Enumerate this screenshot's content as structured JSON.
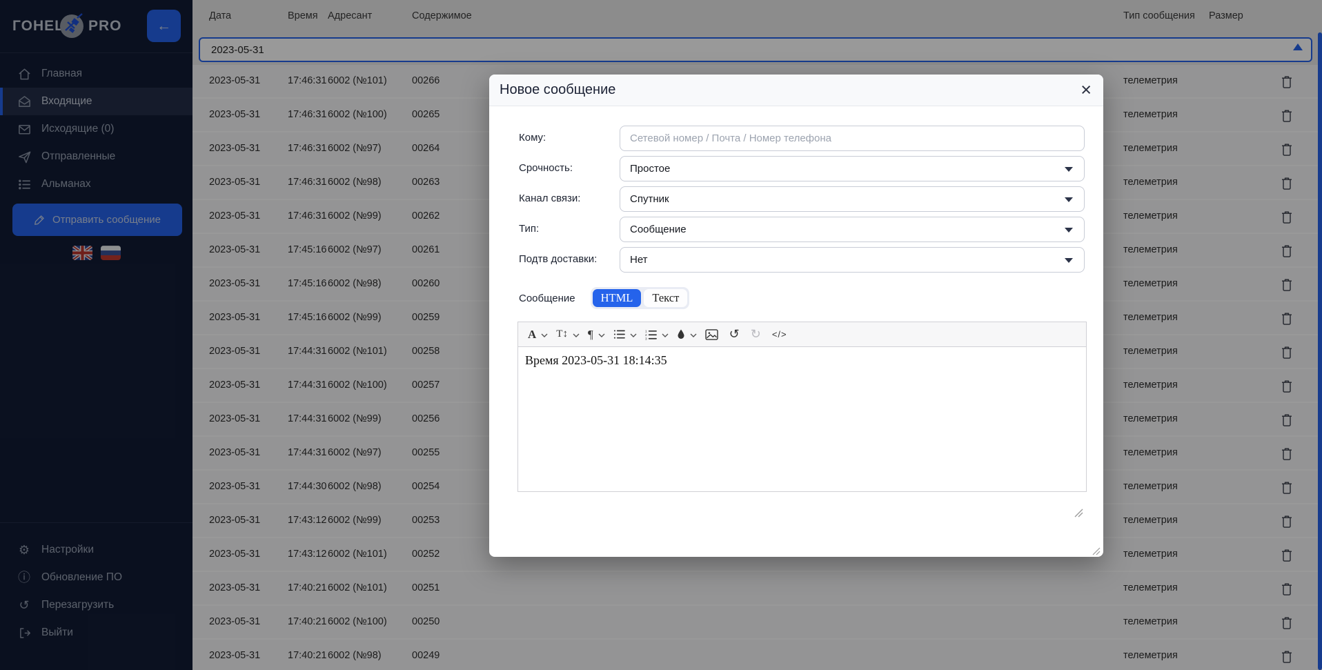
{
  "app": {
    "logo_left": "ГОНЕЦ",
    "logo_right": "PRO",
    "collapse_arrow": "←"
  },
  "colors": {
    "accent_blue": "#2563eb",
    "sidebar_bg": "#121c35",
    "table_header_bg": "#e9e9ea",
    "row_bg": "#f7f7f9",
    "modal_header_bg": "#f8f9fb"
  },
  "sidebar": {
    "nav": [
      {
        "label": "Главная",
        "icon": "home-icon",
        "active": false
      },
      {
        "label": "Входящие",
        "icon": "inbox-open-icon",
        "active": true
      },
      {
        "label": "Исходящие (0)",
        "icon": "envelope-icon",
        "active": false
      },
      {
        "label": "Отправленные",
        "icon": "paper-plane-icon",
        "active": false
      },
      {
        "label": "Альманах",
        "icon": "list-icon",
        "active": false
      }
    ],
    "send_button_label": "Отправить сообщение",
    "flags": [
      "uk-flag",
      "ru-flag"
    ],
    "bottom_nav": [
      {
        "label": "Настройки",
        "icon": "gear-icon",
        "glyph": "⚙"
      },
      {
        "label": "Обновление ПО",
        "icon": "info-icon",
        "glyph": "ⓘ"
      },
      {
        "label": "Перезагрузить",
        "icon": "reload-icon",
        "glyph": "↺"
      },
      {
        "label": "Выйти",
        "icon": "logout-icon",
        "glyph": ""
      }
    ]
  },
  "table": {
    "columns": [
      "Дата",
      "Время",
      "Адресант",
      "Содержимое",
      "Тип сообщения",
      "Размер"
    ],
    "filter": {
      "value": "2023-05-31",
      "sort_icon": "asc-triangle"
    },
    "rows": [
      {
        "date": "2023-05-31",
        "time": "17:46:31",
        "sender": "6002 (№101)",
        "content": "00266",
        "type": "телеметрия"
      },
      {
        "date": "2023-05-31",
        "time": "17:46:31",
        "sender": "6002 (№100)",
        "content": "00265",
        "type": "телеметрия"
      },
      {
        "date": "2023-05-31",
        "time": "17:46:31",
        "sender": "6002 (№97)",
        "content": "00264",
        "type": "телеметрия"
      },
      {
        "date": "2023-05-31",
        "time": "17:46:31",
        "sender": "6002 (№98)",
        "content": "00263",
        "type": "телеметрия"
      },
      {
        "date": "2023-05-31",
        "time": "17:46:31",
        "sender": "6002 (№99)",
        "content": "00262",
        "type": "телеметрия"
      },
      {
        "date": "2023-05-31",
        "time": "17:45:16",
        "sender": "6002 (№97)",
        "content": "00261",
        "type": "телеметрия"
      },
      {
        "date": "2023-05-31",
        "time": "17:45:16",
        "sender": "6002 (№98)",
        "content": "00260",
        "type": "телеметрия"
      },
      {
        "date": "2023-05-31",
        "time": "17:45:16",
        "sender": "6002 (№99)",
        "content": "00259",
        "type": "телеметрия"
      },
      {
        "date": "2023-05-31",
        "time": "17:44:31",
        "sender": "6002 (№101)",
        "content": "00258",
        "type": "телеметрия"
      },
      {
        "date": "2023-05-31",
        "time": "17:44:31",
        "sender": "6002 (№100)",
        "content": "00257",
        "type": "телеметрия"
      },
      {
        "date": "2023-05-31",
        "time": "17:44:31",
        "sender": "6002 (№99)",
        "content": "00256",
        "type": "телеметрия"
      },
      {
        "date": "2023-05-31",
        "time": "17:44:31",
        "sender": "6002 (№97)",
        "content": "00255",
        "type": "телеметрия"
      },
      {
        "date": "2023-05-31",
        "time": "17:44:30",
        "sender": "6002 (№98)",
        "content": "00254",
        "type": "телеметрия"
      },
      {
        "date": "2023-05-31",
        "time": "17:43:12",
        "sender": "6002 (№99)",
        "content": "00253",
        "type": "телеметрия"
      },
      {
        "date": "2023-05-31",
        "time": "17:43:12",
        "sender": "6002 (№101)",
        "content": "00252",
        "type": "телеметрия"
      },
      {
        "date": "2023-05-31",
        "time": "17:40:21",
        "sender": "6002 (№101)",
        "content": "00251",
        "type": "телеметрия"
      },
      {
        "date": "2023-05-31",
        "time": "17:40:21",
        "sender": "6002 (№100)",
        "content": "00250",
        "type": "телеметрия"
      },
      {
        "date": "2023-05-31",
        "time": "17:40:21",
        "sender": "6002 (№98)",
        "content": "00249",
        "type": "телеметрия"
      }
    ]
  },
  "modal": {
    "title": "Новое сообщение",
    "close_glyph": "×",
    "fields": [
      {
        "label": "Кому:",
        "type": "input",
        "placeholder": "Сетевой номер / Почта / Номер телефона"
      },
      {
        "label": "Срочность:",
        "type": "select",
        "value": "Простое"
      },
      {
        "label": "Канал связи:",
        "type": "select",
        "value": "Спутник"
      },
      {
        "label": "Тип:",
        "type": "select",
        "value": "Сообщение"
      },
      {
        "label": "Подтв доставки:",
        "type": "select",
        "value": "Нет"
      }
    ],
    "message_label": "Сообщение",
    "format_toggle": {
      "active": "HTML",
      "options": [
        "HTML",
        "Текст"
      ]
    },
    "editor": {
      "content": "Время 2023-05-31 18:14:35",
      "toolbar_icons": [
        "font-icon",
        "text-size-icon",
        "paragraph-icon",
        "bullet-list-icon",
        "numbered-list-icon",
        "color-drop-icon",
        "image-icon",
        "undo-icon",
        "redo-icon",
        "code-icon"
      ],
      "glyphs": {
        "font": "A",
        "text_size": "T↕",
        "paragraph": "¶",
        "undo": "↺",
        "redo": "↻",
        "code": "</>"
      }
    }
  }
}
